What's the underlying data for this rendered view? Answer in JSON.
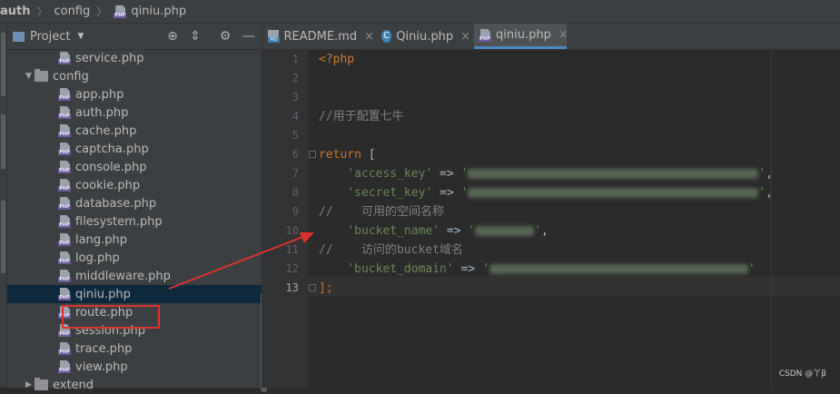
{
  "breadcrumb": [
    "auth",
    "config",
    "qiniu.php"
  ],
  "project_panel": {
    "title": "Project",
    "items": [
      {
        "label": "service.php",
        "type": "php"
      },
      {
        "label": "config",
        "type": "folder"
      },
      {
        "label": "app.php",
        "type": "php"
      },
      {
        "label": "auth.php",
        "type": "php"
      },
      {
        "label": "cache.php",
        "type": "php"
      },
      {
        "label": "captcha.php",
        "type": "php"
      },
      {
        "label": "console.php",
        "type": "php"
      },
      {
        "label": "cookie.php",
        "type": "php"
      },
      {
        "label": "database.php",
        "type": "php"
      },
      {
        "label": "filesystem.php",
        "type": "php"
      },
      {
        "label": "lang.php",
        "type": "php"
      },
      {
        "label": "log.php",
        "type": "php"
      },
      {
        "label": "middleware.php",
        "type": "php"
      },
      {
        "label": "qiniu.php",
        "type": "php"
      },
      {
        "label": "route.php",
        "type": "php"
      },
      {
        "label": "session.php",
        "type": "php"
      },
      {
        "label": "trace.php",
        "type": "php"
      },
      {
        "label": "view.php",
        "type": "php"
      },
      {
        "label": "extend",
        "type": "folder"
      }
    ],
    "selected": "qiniu.php"
  },
  "tabs": [
    {
      "label": "README.md",
      "icon": "markdown-icon"
    },
    {
      "label": "Qiniu.php",
      "icon": "class-icon"
    },
    {
      "label": "qiniu.php",
      "icon": "php-icon",
      "active": true
    }
  ],
  "editor": {
    "line_numbers": [
      "1",
      "2",
      "3",
      "4",
      "5",
      "6",
      "7",
      "8",
      "9",
      "10",
      "11",
      "12",
      "13"
    ],
    "current_line": "13",
    "code": {
      "l1": "<?php",
      "l4": "//用于配置七牛",
      "l6_kw": "return",
      "l6_rest": " [",
      "l7_key": "'access_key'",
      "l7_op": " => ",
      "l8_key": "'secret_key'",
      "l8_op": " => ",
      "l9": "//    可用的空间名称",
      "l10_key": "'bucket_name'",
      "l10_op": " => ",
      "l11": "//    访问的bucket域名",
      "l12_key": "'bucket_domain'",
      "l12_op": " => ",
      "l13": "];",
      "quote": "'",
      "comma": ","
    }
  },
  "watermark": "CSDN @丫β",
  "colors": {
    "keyword": "#cc7832",
    "string": "#6a8759",
    "comment": "#808080",
    "highlight_box": "#e0312f",
    "active_tab_underline": "#4a88c7"
  }
}
